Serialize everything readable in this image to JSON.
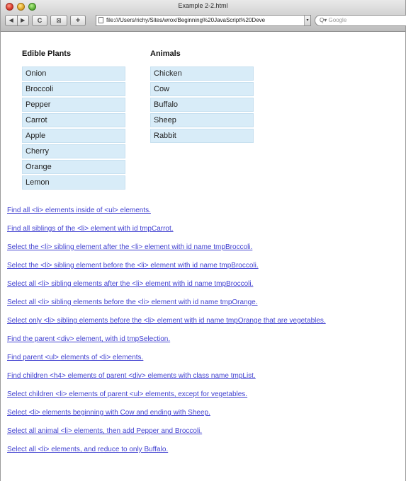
{
  "window": {
    "title": "Example 2-2.html",
    "url": "file:///Users/richy/Sites/wrox/Beginning%20JavaScript%20Deve",
    "search_placeholder": "Google",
    "toolbar": {
      "back": "◀",
      "forward": "▶",
      "reload": "C",
      "snapback": "⊠",
      "add": "+"
    }
  },
  "edible_plants": {
    "heading": "Edible Plants",
    "items": [
      "Onion",
      "Broccoli",
      "Pepper",
      "Carrot",
      "Apple",
      "Cherry",
      "Orange",
      "Lemon"
    ]
  },
  "animals": {
    "heading": "Animals",
    "items": [
      "Chicken",
      "Cow",
      "Buffalo",
      "Sheep",
      "Rabbit"
    ]
  },
  "actions": [
    "Find all <li> elements inside of <ul> elements.",
    "Find all siblings of the <li> element with id tmpCarrot.",
    "Select the <li> sibling element after the <li> element with id name tmpBroccoli.",
    "Select the <li> sibling element before the <li> element with id name tmpBroccoli.",
    "Select all <li> sibling elements after the <li> element with id name tmpBroccoli.",
    "Select all <li> sibling elements before the <li> element with id name tmpOrange.",
    "Select only <li> sibling elements before the <li> element with id name tmpOrange that are vegetables.",
    "Find the parent <div> element, with id tmpSelection.",
    "Find parent <ul> elements of <li> elements.",
    "Find children <h4> elements of parent <div> elements with class name tmpList.",
    "Select children <li> elements of parent <ul> elements, except for vegetables.",
    "Select <li> elements beginning with Cow and ending with Sheep.",
    "Select all animal <li> elements, then add Pepper and Broccoli.",
    "Select all <li> elements, and reduce to only Buffalo."
  ],
  "colors": {
    "list_bg": "#d8ecf8",
    "link": "#3f3fd0"
  }
}
